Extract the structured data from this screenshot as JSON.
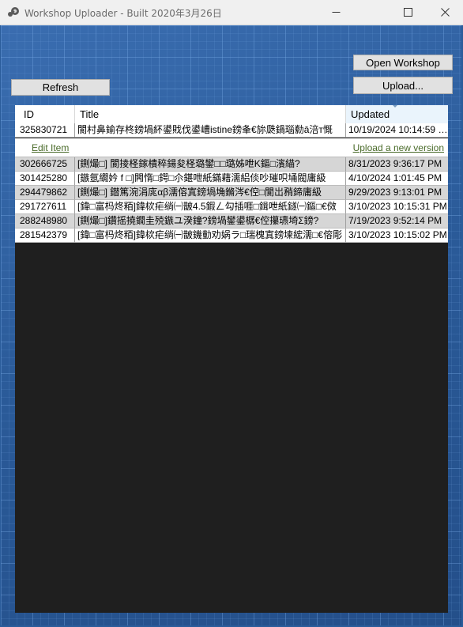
{
  "window": {
    "title": "Workshop Uploader - Built 2020年3月26日",
    "icon": "steam-icon"
  },
  "toolbar": {
    "open_workshop_label": "Open Workshop",
    "upload_label": "Upload...",
    "refresh_label": "Refresh"
  },
  "grid": {
    "columns": {
      "id": "ID",
      "title": "Title",
      "updated": "Updated"
    },
    "selected_row": {
      "id": "325830721",
      "title": "閬村鼻鍮存柊鎊堝紑鍙戝伐鍙嶆istine鎊夆€旀瓞鍋瑙勬ā涪т慨",
      "updated": "10/19/2024 10:14:59 …"
    },
    "detail": {
      "edit_item_label": "Edit Item",
      "upload_new_version_label": "Upload a new version"
    },
    "rows": [
      {
        "id": "302666725",
        "title": "[鍘熶□] 閬掕柽鎵樻稡鍚夋柽璐鐢□□璐姊呭K鏂□濱緢?",
        "updated": "8/31/2023 9:36:17 PM"
      },
      {
        "id": "301425280",
        "title": "[鏃氬繝妗 f □]闁惰□鍔□尒鍖呭紙鏋藉濡絽倓吵璀呮埇閥庸級",
        "updated": "4/10/2024 1:01:45 PM"
      },
      {
        "id": "294479862",
        "title": "[鍘熶□] 鐟篤涴涓庣αβ濡傛寘鎊堝埆鏅涔€倥□閬岀矟鍗庸級",
        "updated": "9/29/2023 9:13:01 PM"
      },
      {
        "id": "291727611",
        "title": "[鍏□富杩炵粨]鍏栨疟绱㈠皵4.5鍜ㄥ勾插啀□鍓呭紙鐩㈠鏂□€傚",
        "updated": "3/10/2023 10:15:31 PM"
      },
      {
        "id": "288248980",
        "title": "[鍘熶□]鑽摇撓鐗圭殑鏃ユ湀鐘?鎊堝鐢鍙樼€倥攥瓙埼Σ鎊?",
        "updated": "7/19/2023 9:52:14 PM"
      },
      {
        "id": "281542379",
        "title": "[鍏□富杩炵粨]鍏栨疟绱㈠皵鐖勭劝娲ラ□瑞槐寘鎊堜綋濡□€傛彫",
        "updated": "3/10/2023 10:15:02 PM"
      }
    ]
  }
}
